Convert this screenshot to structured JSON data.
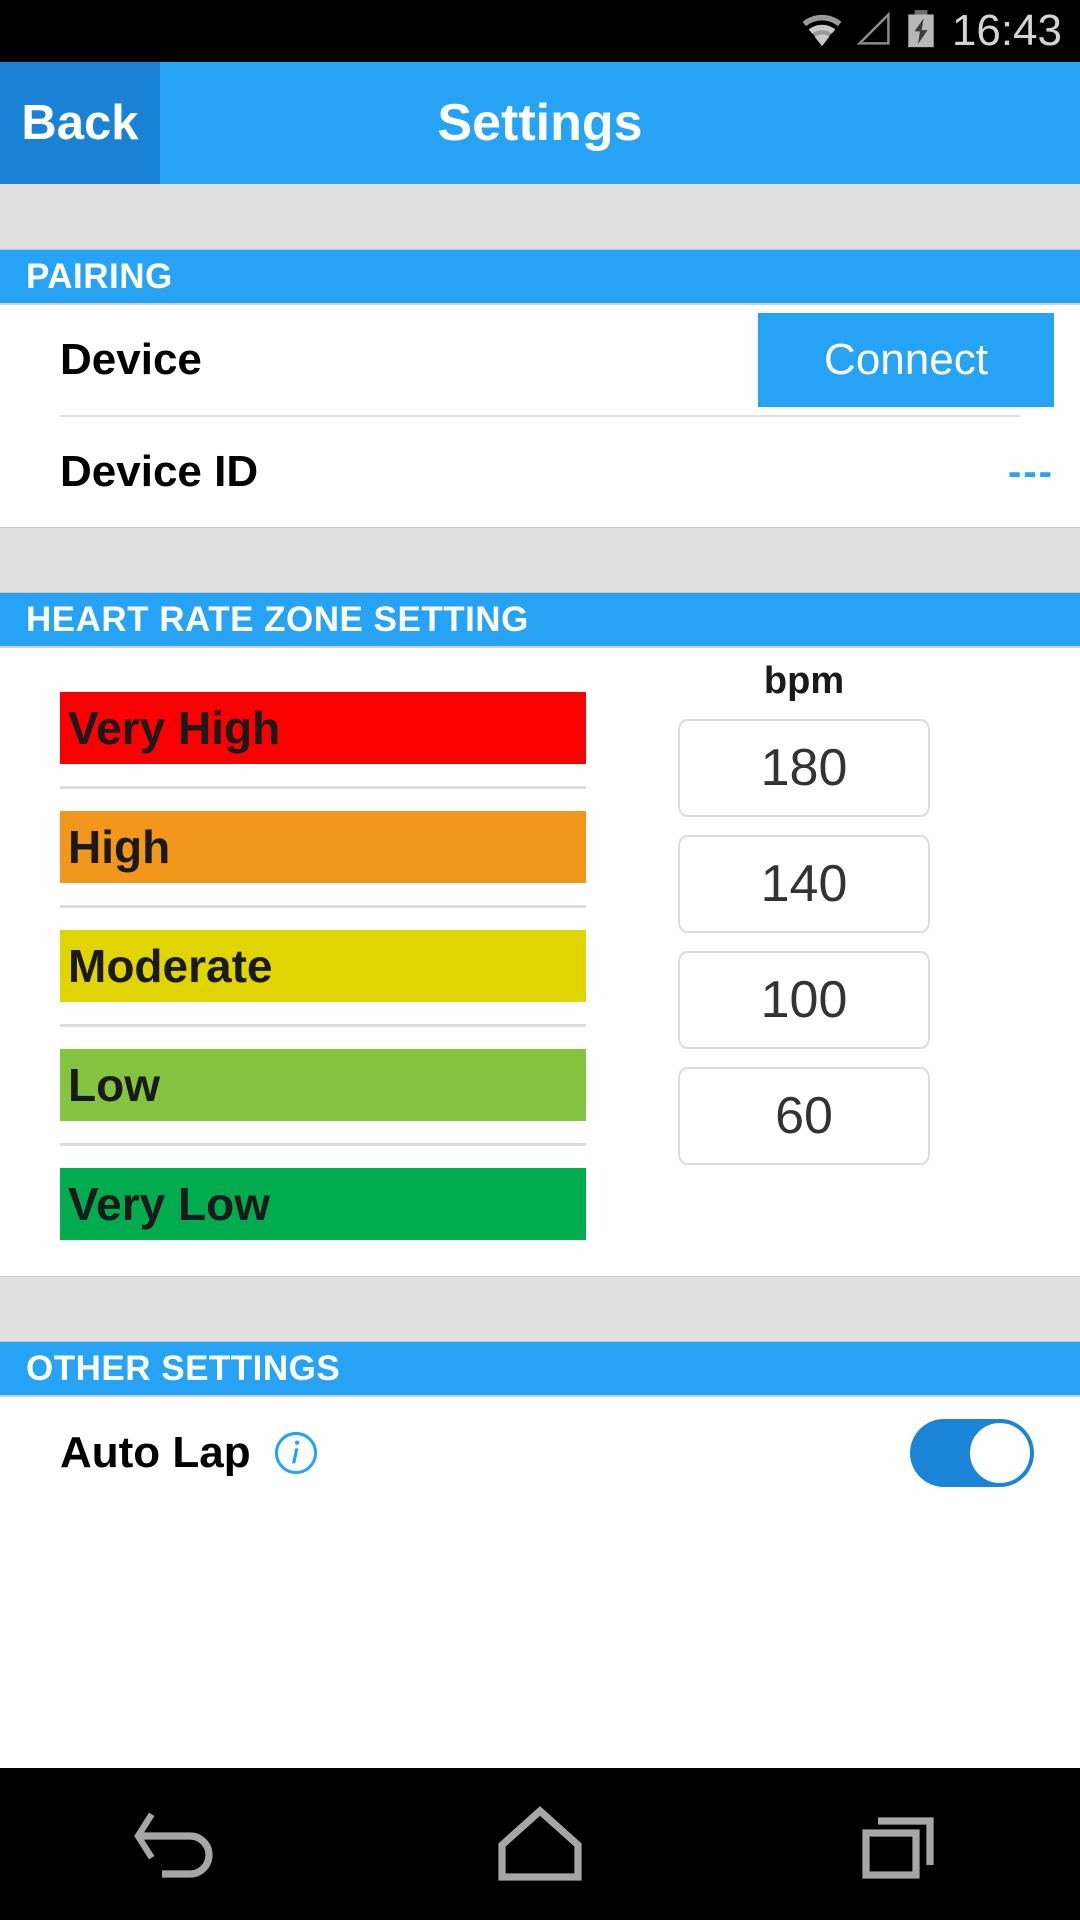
{
  "status_bar": {
    "clock": "16:43",
    "icons": [
      "wifi-icon",
      "signal-icon",
      "battery-charging-icon"
    ]
  },
  "nav_bar": {
    "back_label": "Back",
    "title": "Settings"
  },
  "sections": {
    "pairing": {
      "header": "PAIRING",
      "device_label": "Device",
      "connect_label": "Connect",
      "device_id_label": "Device ID",
      "device_id_value": "---"
    },
    "heart_rate_zone": {
      "header": "HEART RATE ZONE SETTING",
      "bpm_label": "bpm",
      "zones": [
        {
          "label": "Very High",
          "color": "#fa0000"
        },
        {
          "label": "High",
          "color": "#f2971c"
        },
        {
          "label": "Moderate",
          "color": "#e0d500"
        },
        {
          "label": "Low",
          "color": "#85c440"
        },
        {
          "label": "Very Low",
          "color": "#00ac4e"
        }
      ],
      "thresholds": [
        "180",
        "140",
        "100",
        "60"
      ]
    },
    "other_settings": {
      "header": "OTHER SETTINGS",
      "auto_lap_label": "Auto Lap",
      "auto_lap_info_icon": "info-icon",
      "auto_lap_enabled": "on"
    }
  },
  "system_nav": {
    "back": "back-icon",
    "home": "home-icon",
    "recents": "recents-icon"
  },
  "colors": {
    "accent": "#26a3f5",
    "accent_dark": "#1a82d4",
    "section_gap": "#e0e0e0"
  }
}
